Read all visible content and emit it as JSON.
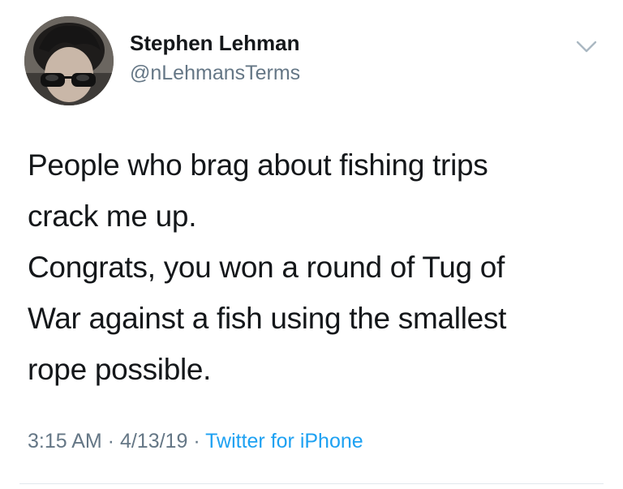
{
  "author": {
    "name": "Stephen Lehman",
    "handle": "@nLehmansTerms",
    "avatar_icon": "profile-photo-sunglasses"
  },
  "menu": {
    "icon": "chevron-down-icon"
  },
  "tweet": {
    "lines": [
      "People who brag about fishing trips",
      "crack me up.",
      "Congrats, you won a round of Tug of",
      "War against a fish using the smallest",
      "rope possible."
    ]
  },
  "meta": {
    "time": "3:15 AM",
    "sep1": " · ",
    "date": "4/13/19",
    "sep2": " · ",
    "source": "Twitter for iPhone"
  },
  "colors": {
    "text": "#14171a",
    "secondary": "#657786",
    "link": "#1da1f2",
    "divider": "#e1e8ed"
  }
}
